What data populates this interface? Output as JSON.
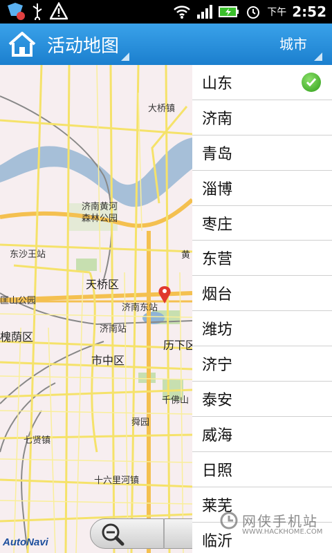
{
  "statusbar": {
    "ampm": "下午",
    "time": "2:52"
  },
  "titlebar": {
    "title": "活动地图",
    "city_button": "城市"
  },
  "map": {
    "labels": [
      {
        "name": "daqiaozhen",
        "text": "大桥镇"
      },
      {
        "name": "senlin-park-1",
        "text": "济南黄河"
      },
      {
        "name": "senlin-park-2",
        "text": "森林公园"
      },
      {
        "name": "dongshawang",
        "text": "东沙王站"
      },
      {
        "name": "tianqiao",
        "text": "天桥区"
      },
      {
        "name": "huang",
        "text": "黄"
      },
      {
        "name": "jinan-east",
        "text": "济南东站"
      },
      {
        "name": "shanpark",
        "text": "匡山公园"
      },
      {
        "name": "huaiyin",
        "text": "槐荫区"
      },
      {
        "name": "jinan-station",
        "text": "济南站"
      },
      {
        "name": "lixia",
        "text": "历下区"
      },
      {
        "name": "shizhong",
        "text": "市中区"
      },
      {
        "name": "qianfoshan",
        "text": "千佛山"
      },
      {
        "name": "shunyuan",
        "text": "舜园"
      },
      {
        "name": "qixian",
        "text": "七贤镇"
      },
      {
        "name": "shiliuli",
        "text": "十六里河镇"
      }
    ],
    "logo": "AutoNavi"
  },
  "cities": [
    {
      "label": "山东",
      "selected": true
    },
    {
      "label": "济南",
      "selected": false
    },
    {
      "label": "青岛",
      "selected": false
    },
    {
      "label": "淄博",
      "selected": false
    },
    {
      "label": "枣庄",
      "selected": false
    },
    {
      "label": "东营",
      "selected": false
    },
    {
      "label": "烟台",
      "selected": false
    },
    {
      "label": "潍坊",
      "selected": false
    },
    {
      "label": "济宁",
      "selected": false
    },
    {
      "label": "泰安",
      "selected": false
    },
    {
      "label": "威海",
      "selected": false
    },
    {
      "label": "日照",
      "selected": false
    },
    {
      "label": "莱芜",
      "selected": false
    },
    {
      "label": "临沂",
      "selected": false
    }
  ],
  "watermark": {
    "text": "网侠手机站",
    "url": "WWW.HACKHOME.COM"
  },
  "colors": {
    "titlebar": "#2a8fdc",
    "map_background": "#f7eef0",
    "river": "#a6bfd8",
    "road": "#f5e26a",
    "check": "#3cae24"
  }
}
